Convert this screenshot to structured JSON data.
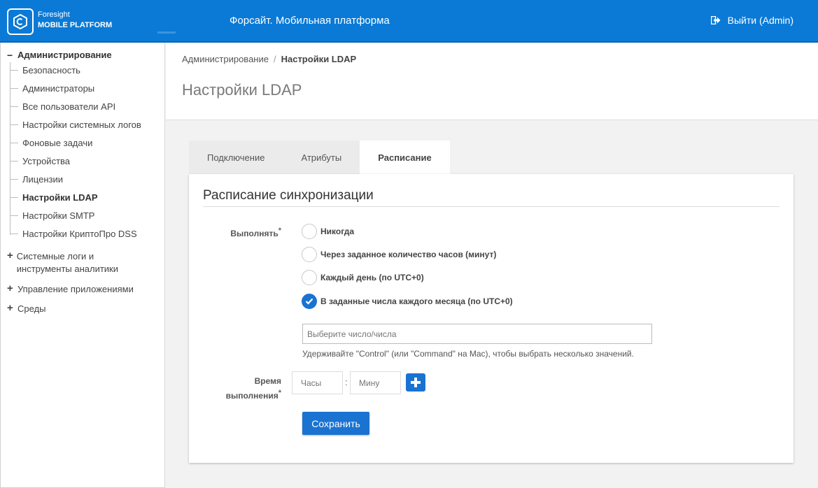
{
  "colors": {
    "header": "#0a7ad6",
    "accent": "#1a73d1"
  },
  "logo": {
    "line1": "Foresight",
    "line2": "MOBILE PLATFORM",
    "icon": "foresight-logo-icon"
  },
  "header": {
    "title": "Форсайт. Мобильная платформа",
    "logout_label": "Выйти (Admin)",
    "logout_icon": "sign-out-icon"
  },
  "sidebar": {
    "root": {
      "sign": "−",
      "label": "Администрирование"
    },
    "items": [
      {
        "label": "Безопасность"
      },
      {
        "label": "Администраторы"
      },
      {
        "label": "Все пользователи API"
      },
      {
        "label": "Настройки системных логов"
      },
      {
        "label": "Фоновые задачи"
      },
      {
        "label": "Устройства"
      },
      {
        "label": "Лицензии"
      },
      {
        "label": "Настройки LDAP",
        "active": true
      },
      {
        "label": "Настройки SMTP"
      },
      {
        "label": "Настройки КриптоПро DSS"
      }
    ],
    "groups": [
      {
        "sign": "+",
        "label": "Системные логи и инструменты аналитики"
      },
      {
        "sign": "+",
        "label": "Управление приложениями"
      },
      {
        "sign": "+",
        "label": "Среды"
      }
    ]
  },
  "breadcrumb": {
    "parent": "Администрирование",
    "separator": "/",
    "current": "Настройки LDAP"
  },
  "page_title": "Настройки LDAP",
  "tabs": [
    {
      "label": "Подключение"
    },
    {
      "label": "Атрибуты"
    },
    {
      "label": "Расписание",
      "active": true
    }
  ],
  "form": {
    "section_title": "Расписание синхронизации",
    "run_label": "Выполнять",
    "required_mark": "*",
    "options": [
      {
        "label": "Никогда",
        "checked": false
      },
      {
        "label": "Через заданное количество часов (минут)",
        "checked": false
      },
      {
        "label": "Каждый день (по UTC+0)",
        "checked": false
      },
      {
        "label": "В заданные числа каждого месяца (по UTC+0)",
        "checked": true
      }
    ],
    "days_placeholder": "Выберите число/числа",
    "hint": "Удерживайте \"Control\" (или \"Command\" на Mac), чтобы выбрать несколько значений.",
    "time_label_line1": "Время",
    "time_label_line2": "выполнения",
    "hours_placeholder": "Часы",
    "time_separator": ":",
    "minutes_placeholder": "Мину",
    "save_label": "Сохранить"
  }
}
